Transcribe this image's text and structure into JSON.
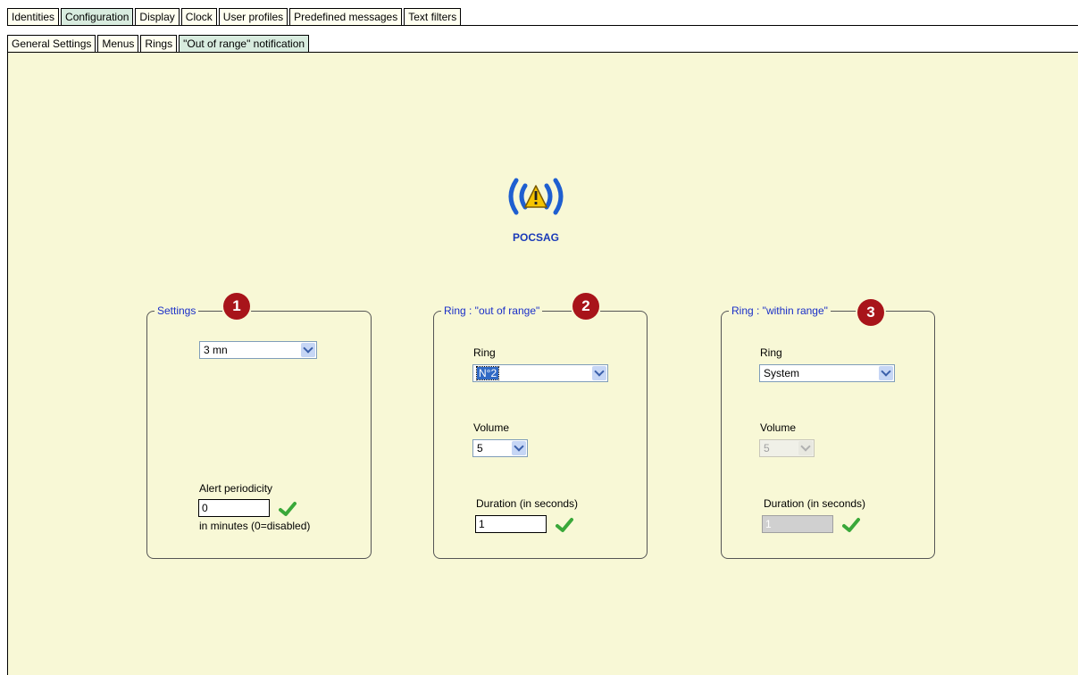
{
  "top_tabs": [
    "Identities",
    "Configuration",
    "Display",
    "Clock",
    "User profiles",
    "Predefined messages",
    "Text filters"
  ],
  "sub_tabs": [
    "General Settings",
    "Menus",
    "Rings",
    "\"Out of range\" notification"
  ],
  "logo": {
    "title": "POCSAG",
    "icon": "pager-warning-icon"
  },
  "settings": {
    "legend": "Settings",
    "badge": "1",
    "select_value": "3 mn",
    "periodicity_label": "Alert periodicity",
    "periodicity_value": "0",
    "periodicity_hint": "in minutes (0=disabled)"
  },
  "out_of_range": {
    "legend": "Ring : \"out of range\"",
    "badge": "2",
    "ring_label": "Ring",
    "ring_value": "N°2",
    "volume_label": "Volume",
    "volume_value": "5",
    "duration_label": "Duration (in seconds)",
    "duration_value": "1"
  },
  "within_range": {
    "legend": "Ring : \"within range\"",
    "badge": "3",
    "ring_label": "Ring",
    "ring_value": "System",
    "volume_label": "Volume",
    "volume_value": "5",
    "duration_label": "Duration (in seconds)",
    "duration_value": "1"
  },
  "colors": {
    "panel": "#f8f8d6",
    "legend": "#1a2fc8",
    "badge": "#a8141a",
    "brand": "#1a3ab8"
  }
}
